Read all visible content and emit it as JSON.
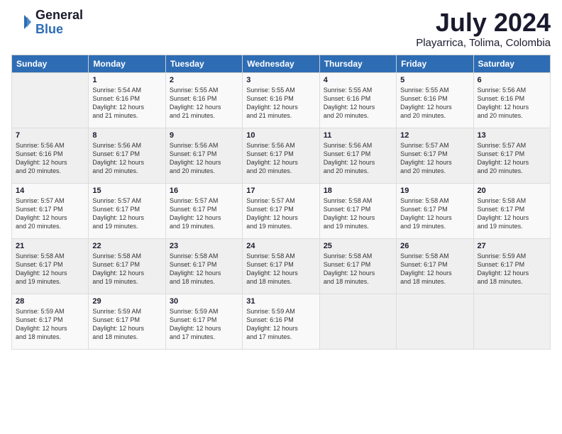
{
  "header": {
    "logo_line1": "General",
    "logo_line2": "Blue",
    "month": "July 2024",
    "location": "Playarrica, Tolima, Colombia"
  },
  "days_of_week": [
    "Sunday",
    "Monday",
    "Tuesday",
    "Wednesday",
    "Thursday",
    "Friday",
    "Saturday"
  ],
  "weeks": [
    [
      {
        "day": "",
        "info": ""
      },
      {
        "day": "1",
        "info": "Sunrise: 5:54 AM\nSunset: 6:16 PM\nDaylight: 12 hours\nand 21 minutes."
      },
      {
        "day": "2",
        "info": "Sunrise: 5:55 AM\nSunset: 6:16 PM\nDaylight: 12 hours\nand 21 minutes."
      },
      {
        "day": "3",
        "info": "Sunrise: 5:55 AM\nSunset: 6:16 PM\nDaylight: 12 hours\nand 21 minutes."
      },
      {
        "day": "4",
        "info": "Sunrise: 5:55 AM\nSunset: 6:16 PM\nDaylight: 12 hours\nand 20 minutes."
      },
      {
        "day": "5",
        "info": "Sunrise: 5:55 AM\nSunset: 6:16 PM\nDaylight: 12 hours\nand 20 minutes."
      },
      {
        "day": "6",
        "info": "Sunrise: 5:56 AM\nSunset: 6:16 PM\nDaylight: 12 hours\nand 20 minutes."
      }
    ],
    [
      {
        "day": "7",
        "info": "Sunrise: 5:56 AM\nSunset: 6:16 PM\nDaylight: 12 hours\nand 20 minutes."
      },
      {
        "day": "8",
        "info": "Sunrise: 5:56 AM\nSunset: 6:17 PM\nDaylight: 12 hours\nand 20 minutes."
      },
      {
        "day": "9",
        "info": "Sunrise: 5:56 AM\nSunset: 6:17 PM\nDaylight: 12 hours\nand 20 minutes."
      },
      {
        "day": "10",
        "info": "Sunrise: 5:56 AM\nSunset: 6:17 PM\nDaylight: 12 hours\nand 20 minutes."
      },
      {
        "day": "11",
        "info": "Sunrise: 5:56 AM\nSunset: 6:17 PM\nDaylight: 12 hours\nand 20 minutes."
      },
      {
        "day": "12",
        "info": "Sunrise: 5:57 AM\nSunset: 6:17 PM\nDaylight: 12 hours\nand 20 minutes."
      },
      {
        "day": "13",
        "info": "Sunrise: 5:57 AM\nSunset: 6:17 PM\nDaylight: 12 hours\nand 20 minutes."
      }
    ],
    [
      {
        "day": "14",
        "info": "Sunrise: 5:57 AM\nSunset: 6:17 PM\nDaylight: 12 hours\nand 20 minutes."
      },
      {
        "day": "15",
        "info": "Sunrise: 5:57 AM\nSunset: 6:17 PM\nDaylight: 12 hours\nand 19 minutes."
      },
      {
        "day": "16",
        "info": "Sunrise: 5:57 AM\nSunset: 6:17 PM\nDaylight: 12 hours\nand 19 minutes."
      },
      {
        "day": "17",
        "info": "Sunrise: 5:57 AM\nSunset: 6:17 PM\nDaylight: 12 hours\nand 19 minutes."
      },
      {
        "day": "18",
        "info": "Sunrise: 5:58 AM\nSunset: 6:17 PM\nDaylight: 12 hours\nand 19 minutes."
      },
      {
        "day": "19",
        "info": "Sunrise: 5:58 AM\nSunset: 6:17 PM\nDaylight: 12 hours\nand 19 minutes."
      },
      {
        "day": "20",
        "info": "Sunrise: 5:58 AM\nSunset: 6:17 PM\nDaylight: 12 hours\nand 19 minutes."
      }
    ],
    [
      {
        "day": "21",
        "info": "Sunrise: 5:58 AM\nSunset: 6:17 PM\nDaylight: 12 hours\nand 19 minutes."
      },
      {
        "day": "22",
        "info": "Sunrise: 5:58 AM\nSunset: 6:17 PM\nDaylight: 12 hours\nand 19 minutes."
      },
      {
        "day": "23",
        "info": "Sunrise: 5:58 AM\nSunset: 6:17 PM\nDaylight: 12 hours\nand 18 minutes."
      },
      {
        "day": "24",
        "info": "Sunrise: 5:58 AM\nSunset: 6:17 PM\nDaylight: 12 hours\nand 18 minutes."
      },
      {
        "day": "25",
        "info": "Sunrise: 5:58 AM\nSunset: 6:17 PM\nDaylight: 12 hours\nand 18 minutes."
      },
      {
        "day": "26",
        "info": "Sunrise: 5:58 AM\nSunset: 6:17 PM\nDaylight: 12 hours\nand 18 minutes."
      },
      {
        "day": "27",
        "info": "Sunrise: 5:59 AM\nSunset: 6:17 PM\nDaylight: 12 hours\nand 18 minutes."
      }
    ],
    [
      {
        "day": "28",
        "info": "Sunrise: 5:59 AM\nSunset: 6:17 PM\nDaylight: 12 hours\nand 18 minutes."
      },
      {
        "day": "29",
        "info": "Sunrise: 5:59 AM\nSunset: 6:17 PM\nDaylight: 12 hours\nand 18 minutes."
      },
      {
        "day": "30",
        "info": "Sunrise: 5:59 AM\nSunset: 6:17 PM\nDaylight: 12 hours\nand 17 minutes."
      },
      {
        "day": "31",
        "info": "Sunrise: 5:59 AM\nSunset: 6:16 PM\nDaylight: 12 hours\nand 17 minutes."
      },
      {
        "day": "",
        "info": ""
      },
      {
        "day": "",
        "info": ""
      },
      {
        "day": "",
        "info": ""
      }
    ]
  ]
}
